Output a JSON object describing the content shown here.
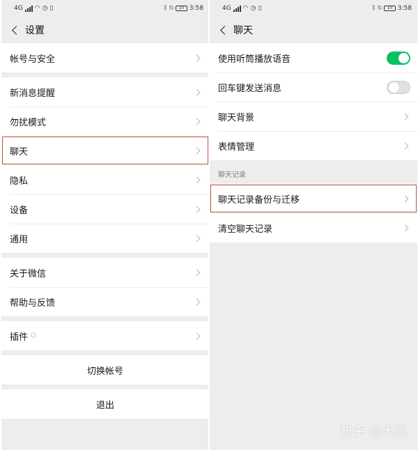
{
  "status_bar": {
    "left": {
      "network": "4G",
      "icons": [
        "signal-icon",
        "wifi-icon",
        "alarm-icon",
        "sim-icon"
      ]
    },
    "right": {
      "icons": [
        "bluetooth-icon",
        "mute-icon"
      ],
      "battery": "10",
      "time": "3:58"
    }
  },
  "settings": {
    "title": "设置",
    "items": {
      "account": "帐号与安全",
      "notifications": "新消息提醒",
      "dnd": "勿扰模式",
      "chat": "聊天",
      "privacy": "隐私",
      "devices": "设备",
      "general": "通用",
      "about": "关于微信",
      "help": "帮助与反馈",
      "plugins": "插件"
    },
    "switch_account": "切换帐号",
    "logout": "退出"
  },
  "chat": {
    "title": "聊天",
    "items": {
      "earpiece": {
        "label": "使用听筒播放语音",
        "state": "on"
      },
      "enter_send": {
        "label": "回车键发送消息",
        "state": "off"
      },
      "background": "聊天背景",
      "stickers": "表情管理"
    },
    "history_header": "聊天记录",
    "history": {
      "backup": "聊天记录备份与迁移",
      "clear": "清空聊天记录"
    }
  },
  "watermark": "知乎 @大鹏",
  "colors": {
    "toggle_on": "#07c160",
    "highlight": "#c8453c",
    "page_bg": "#ededed"
  }
}
